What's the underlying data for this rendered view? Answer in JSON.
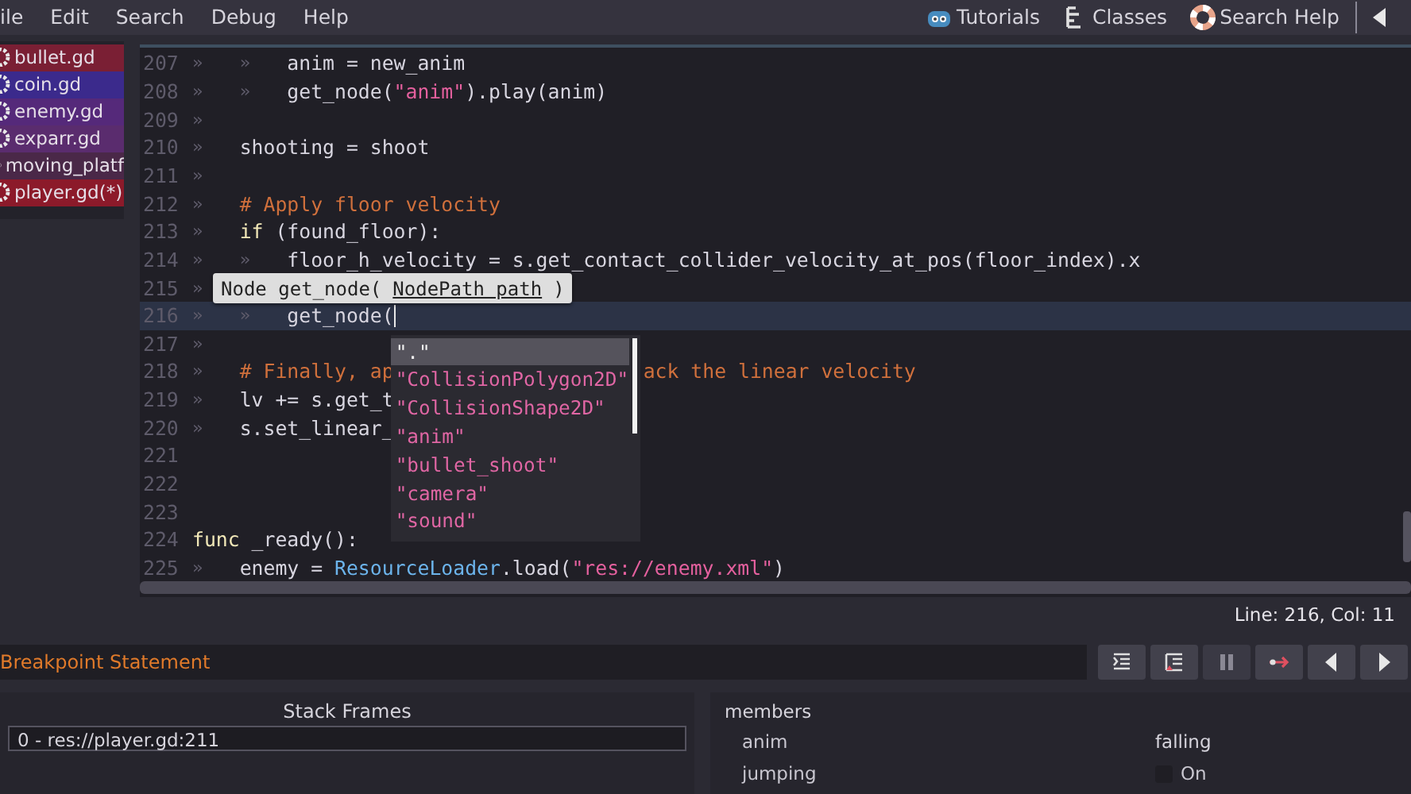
{
  "menu": [
    "ile",
    "Edit",
    "Search",
    "Debug",
    "Help"
  ],
  "help_links": [
    {
      "kind": "tutorials",
      "label": "Tutorials"
    },
    {
      "kind": "classes",
      "label": "Classes"
    },
    {
      "kind": "search",
      "label": "Search Help"
    }
  ],
  "files": [
    {
      "name": "bullet.gd",
      "color": "#7a1f34"
    },
    {
      "name": "coin.gd",
      "color": "#3b2a8c"
    },
    {
      "name": "enemy.gd",
      "color": "#55297a"
    },
    {
      "name": "exparr.gd",
      "color": "#5a2c6e"
    },
    {
      "name": "moving_platf",
      "color": "#4a2848"
    },
    {
      "name": "player.gd(*)",
      "color": "#8c1a2a"
    }
  ],
  "code": [
    {
      "number": "207",
      "indent": [
        "»",
        "»"
      ],
      "current": false,
      "tokens": [
        {
          "kind": "plain",
          "text": "anim = new_anim"
        }
      ]
    },
    {
      "number": "208",
      "indent": [
        "»",
        "»"
      ],
      "current": false,
      "tokens": [
        {
          "kind": "plain",
          "text": "get_node("
        },
        {
          "kind": "string",
          "text": "\"anim\""
        },
        {
          "kind": "plain",
          "text": ").play(anim)"
        }
      ]
    },
    {
      "number": "209",
      "indent": [
        "»"
      ],
      "current": false
    },
    {
      "number": "210",
      "indent": [
        "»"
      ],
      "current": false,
      "tokens": [
        {
          "kind": "plain",
          "text": "shooting = shoot"
        }
      ]
    },
    {
      "number": "211",
      "indent": [
        "»"
      ],
      "current": false
    },
    {
      "number": "212",
      "indent": [
        "»"
      ],
      "current": false,
      "tokens": [
        {
          "kind": "comment",
          "text": "# Apply floor velocity"
        }
      ]
    },
    {
      "number": "213",
      "indent": [
        "»"
      ],
      "current": false,
      "tokens": [
        {
          "kind": "keyword",
          "text": "if"
        },
        {
          "kind": "plain",
          "text": " (found_floor):"
        }
      ]
    },
    {
      "number": "214",
      "indent": [
        "»",
        "»"
      ],
      "current": false,
      "tokens": [
        {
          "kind": "plain",
          "text": "floor_h_velocity = s.get_contact_collider_velocity_at_pos(floor_index).x"
        }
      ]
    },
    {
      "number": "215",
      "indent": [
        "»"
      ],
      "current": false
    },
    {
      "number": "216",
      "indent": [
        "»",
        "»"
      ],
      "current": true,
      "tokens": [
        {
          "kind": "plain",
          "text": "get_node("
        }
      ]
    },
    {
      "number": "217",
      "indent": [
        "»"
      ],
      "current": false
    },
    {
      "number": "218",
      "indent": [
        "»"
      ],
      "current": false,
      "tokens": [
        {
          "kind": "comment",
          "text": "# Finally, ap"
        }
      ],
      "after_popup": [
        {
          "kind": "comment",
          "text": "ack the linear velocity"
        }
      ]
    },
    {
      "number": "219",
      "indent": [
        "»"
      ],
      "current": false,
      "tokens": [
        {
          "kind": "plain",
          "text": "lv += s.get_t"
        }
      ]
    },
    {
      "number": "220",
      "indent": [
        "»"
      ],
      "current": false,
      "tokens": [
        {
          "kind": "plain",
          "text": "s.set_linear_"
        }
      ]
    },
    {
      "number": "221",
      "current": false
    },
    {
      "number": "222",
      "current": false
    },
    {
      "number": "223",
      "current": false
    },
    {
      "number": "224",
      "current": false,
      "tokens": [
        {
          "kind": "keyword",
          "text": "func"
        },
        {
          "kind": "plain",
          "text": " _ready():"
        }
      ]
    },
    {
      "number": "225",
      "indent": [
        "»"
      ],
      "current": false,
      "tokens": [
        {
          "kind": "plain",
          "text": "enemy = "
        },
        {
          "kind": "class",
          "text": "ResourceLoader"
        },
        {
          "kind": "plain",
          "text": ".load("
        },
        {
          "kind": "string",
          "text": "\"res://enemy.xml\""
        },
        {
          "kind": "plain",
          "text": ")"
        }
      ]
    }
  ],
  "call_tip": {
    "prefix": "Node get_node(",
    "argument": "NodePath path",
    "suffix": ")"
  },
  "completion": [
    {
      "text": "\".\"",
      "selected": true
    },
    {
      "text": "\"CollisionPolygon2D\"",
      "selected": false
    },
    {
      "text": "\"CollisionShape2D\"",
      "selected": false
    },
    {
      "text": "\"anim\"",
      "selected": false
    },
    {
      "text": "\"bullet_shoot\"",
      "selected": false
    },
    {
      "text": "\"camera\"",
      "selected": false
    },
    {
      "text": "\"sound\"",
      "selected": false
    }
  ],
  "status": "Line: 216, Col: 11",
  "debugger": {
    "message": "Breakpoint Statement",
    "buttons": [
      {
        "kind": "step-into"
      },
      {
        "kind": "step-over"
      },
      {
        "kind": "pause"
      },
      {
        "kind": "break"
      },
      {
        "kind": "prev"
      },
      {
        "kind": "next"
      }
    ]
  },
  "stack_frames": {
    "title": "Stack Frames",
    "frames": [
      {
        "text": "0 - res://player.gd:211",
        "selected": true
      }
    ]
  },
  "inspector": {
    "title": "members",
    "rows": [
      {
        "kind": "text",
        "name": "anim",
        "value": "falling"
      },
      {
        "kind": "check",
        "name": "jumping",
        "value": "On",
        "checked": false
      }
    ]
  }
}
